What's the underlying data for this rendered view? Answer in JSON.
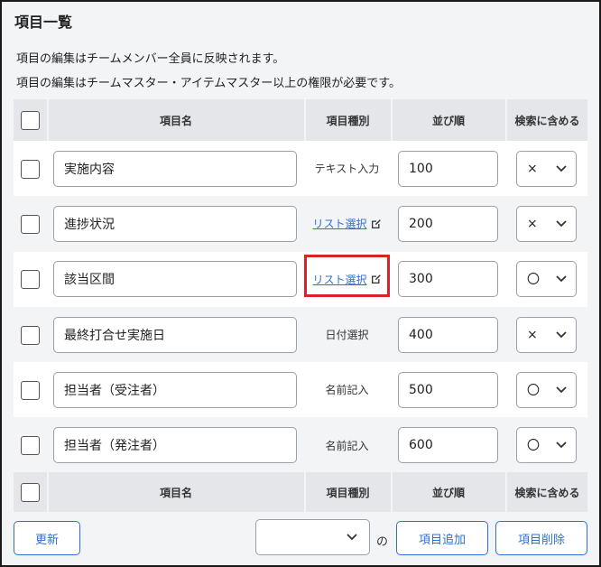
{
  "header": {
    "title": "項目一覧",
    "note1": "項目の編集はチームメンバー全員に反映されます。",
    "note2": "項目の編集はチームマスター・アイテムマスター以上の権限が必要です。"
  },
  "columns": {
    "name": "項目名",
    "type": "項目種別",
    "order": "並び順",
    "search": "検索に含める"
  },
  "rows": [
    {
      "name": "実施内容",
      "type": "テキスト入力",
      "type_is_link": false,
      "order": "100",
      "search": "×"
    },
    {
      "name": "進捗状況",
      "type": "リスト選択",
      "type_is_link": true,
      "order": "200",
      "search": "×"
    },
    {
      "name": "該当区間",
      "type": "リスト選択",
      "type_is_link": true,
      "order": "300",
      "search": "〇"
    },
    {
      "name": "最終打合せ実施日",
      "type": "日付選択",
      "type_is_link": false,
      "order": "400",
      "search": "×"
    },
    {
      "name": "担当者（受注者）",
      "type": "名前記入",
      "type_is_link": false,
      "order": "500",
      "search": "〇"
    },
    {
      "name": "担当者（発注者）",
      "type": "名前記入",
      "type_is_link": false,
      "order": "600",
      "search": "〇"
    }
  ],
  "footer": {
    "update_label": "更新",
    "position_value": "",
    "no_label": "の",
    "add_label": "項目追加",
    "delete_label": "項目削除"
  },
  "colors": {
    "link": "#2f6fd6",
    "highlight": "#d8232a",
    "header_bg": "#e4e6ea"
  }
}
